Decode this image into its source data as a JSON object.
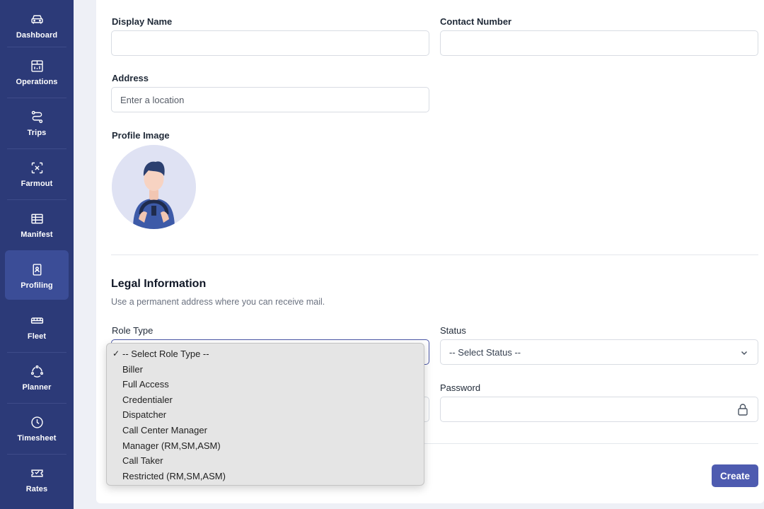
{
  "sidebar": {
    "items": [
      {
        "label": "Dashboard",
        "icon": "car-icon"
      },
      {
        "label": "Operations",
        "icon": "calendar-chart-icon"
      },
      {
        "label": "Trips",
        "icon": "route-icon"
      },
      {
        "label": "Farmout",
        "icon": "scan-icon"
      },
      {
        "label": "Manifest",
        "icon": "table-icon"
      },
      {
        "label": "Profiling",
        "icon": "id-badge-icon",
        "active": true
      },
      {
        "label": "Fleet",
        "icon": "bus-icon"
      },
      {
        "label": "Planner",
        "icon": "planner-icon"
      },
      {
        "label": "Timesheet",
        "icon": "clock-icon"
      },
      {
        "label": "Rates",
        "icon": "ticket-icon"
      }
    ]
  },
  "form": {
    "display_name_label": "Display Name",
    "contact_number_label": "Contact Number",
    "address_label": "Address",
    "address_placeholder": "Enter a location",
    "profile_image_label": "Profile Image",
    "legal_title": "Legal Information",
    "legal_subtitle": "Use a permanent address where you can receive mail.",
    "role_type_label": "Role Type",
    "status_label": "Status",
    "status_value": "-- Select Status --",
    "password_label": "Password",
    "create_label": "Create"
  },
  "role_dropdown": {
    "selected": "-- Select Role Type --",
    "options": [
      "-- Select Role Type --",
      "Biller",
      "Full Access",
      "Credentialer",
      "Dispatcher",
      "Call Center Manager",
      "Manager (RM,SM,ASM)",
      "Call Taker",
      "Restricted (RM,SM,ASM)"
    ]
  },
  "colors": {
    "sidebar_bg": "#2c3a78",
    "sidebar_active": "#3b4d97",
    "primary": "#4e5bb0",
    "page_bg": "#eef0f6"
  }
}
